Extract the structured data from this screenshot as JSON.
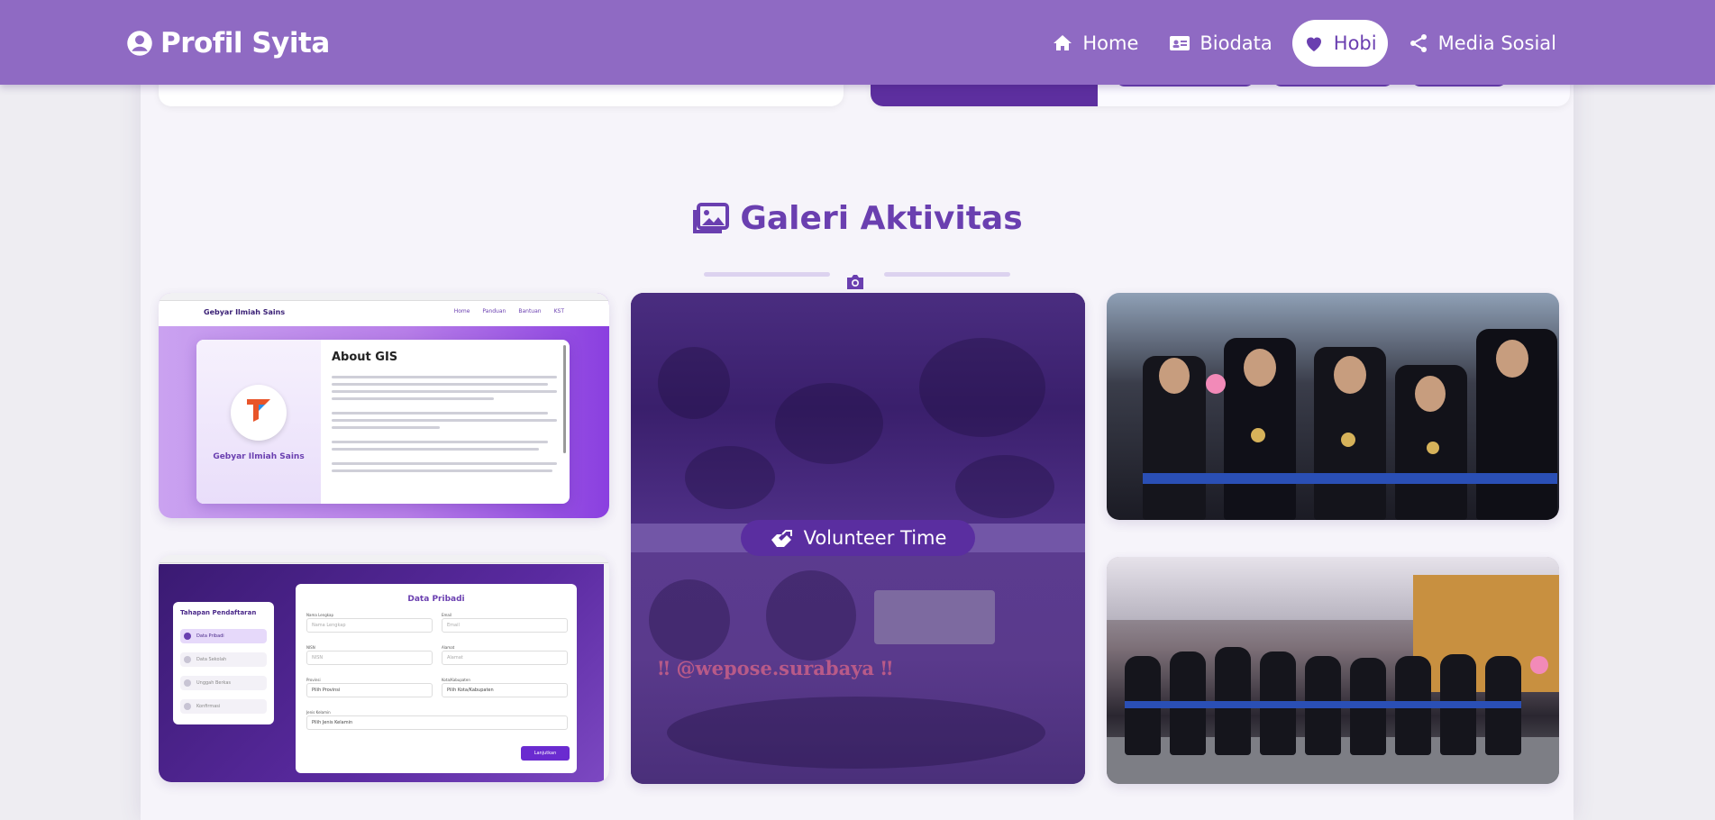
{
  "navbar": {
    "brand": "Profil Syita",
    "items": [
      {
        "label": "Home",
        "icon": "home-icon",
        "active": false
      },
      {
        "label": "Biodata",
        "icon": "id-card-icon",
        "active": false
      },
      {
        "label": "Hobi",
        "icon": "heart-icon",
        "active": true
      },
      {
        "label": "Media Sosial",
        "icon": "share-icon",
        "active": false
      }
    ],
    "colors": {
      "bar": "#8f6ac3",
      "accent": "#6a3fb0"
    }
  },
  "gallery": {
    "title": "Galeri Aktivitas",
    "title_icon": "images-icon",
    "divider_icon": "camera-icon",
    "featured_caption": "Volunteer Time",
    "featured_icon": "hands-helping-icon"
  },
  "screens": {
    "about": {
      "site_name": "Gebyar Ilmiah Sains",
      "nav_links": [
        "Home",
        "Panduan",
        "Bantuan",
        "KST"
      ],
      "card_title": "About GIS",
      "org_name": "Gebyar Ilmiah Sains"
    },
    "form": {
      "steps_title": "Tahapan Pendaftaran",
      "steps": [
        "Data Pribadi",
        "Data Sekolah",
        "Unggah Berkas",
        "Konfirmasi"
      ],
      "form_title": "Data Pribadi",
      "fields": [
        {
          "label": "Nama Lengkap",
          "placeholder": "Nama Lengkap"
        },
        {
          "label": "Email",
          "placeholder": "Email"
        },
        {
          "label": "NISN",
          "placeholder": "NISN"
        },
        {
          "label": "Alamat",
          "placeholder": "Alamat"
        },
        {
          "label": "Provinsi",
          "placeholder": "Pilih Provinsi"
        },
        {
          "label": "Kota/Kabupaten",
          "placeholder": "Pilih Kota/Kabupaten"
        },
        {
          "label": "Jenis Kelamin",
          "placeholder": "Pilih Jenis Kelamin"
        }
      ],
      "submit": "Lanjutkan"
    },
    "watermark": "‼ @wepose.surabaya ‼"
  }
}
